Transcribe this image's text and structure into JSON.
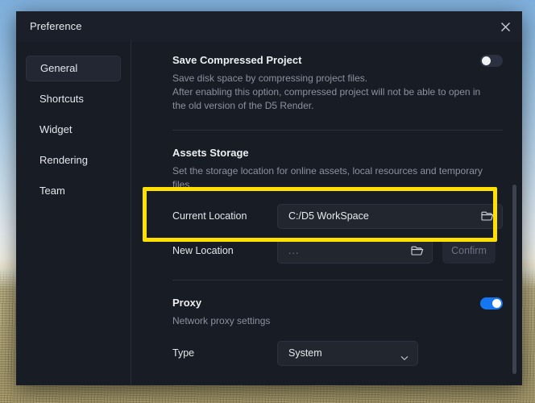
{
  "window": {
    "title": "Preference",
    "close_icon": "close-icon"
  },
  "sidebar": {
    "items": [
      {
        "label": "General",
        "active": true
      },
      {
        "label": "Shortcuts",
        "active": false
      },
      {
        "label": "Widget",
        "active": false
      },
      {
        "label": "Rendering",
        "active": false
      },
      {
        "label": "Team",
        "active": false
      }
    ]
  },
  "sections": {
    "save_compressed": {
      "title": "Save Compressed Project",
      "desc_line1": "Save disk space by compressing project files.",
      "desc_line2": "After enabling this option, compressed project will not be able to open in",
      "desc_line3": "the old version of the D5 Render.",
      "toggle_state": "off"
    },
    "assets_storage": {
      "title": "Assets Storage",
      "desc_line1": "Set the storage location for online assets, local resources and temporary",
      "desc_line2": "files.",
      "current_location_label": "Current Location",
      "current_location_value": "C:/D5 WorkSpace",
      "current_location_browse_icon": "folder-icon",
      "new_location_label": "New Location",
      "new_location_placeholder": "...",
      "new_location_browse_icon": "folder-icon",
      "confirm_label": "Confirm"
    },
    "proxy": {
      "title": "Proxy",
      "desc": "Network proxy settings",
      "toggle_state": "on",
      "type_label": "Type",
      "type_value": "System",
      "type_caret_icon": "chevron-down-icon"
    }
  },
  "colors": {
    "accent_blue": "#1577ef",
    "highlight_yellow": "#ffe000",
    "panel_bg": "#181c25",
    "field_bg": "#21262f"
  }
}
